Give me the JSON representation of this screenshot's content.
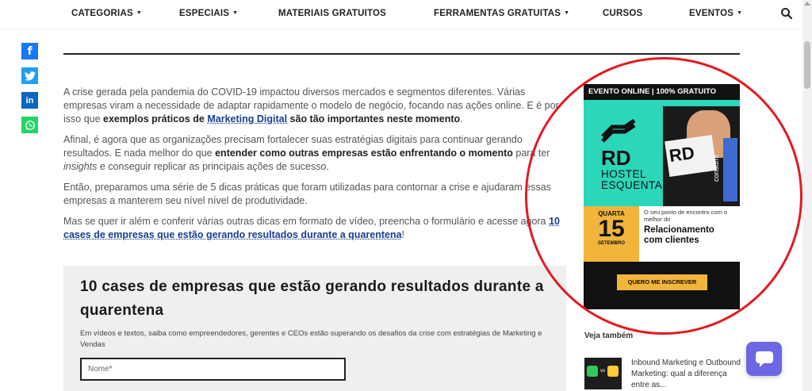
{
  "nav": {
    "items": [
      {
        "label": "CATEGORIAS",
        "dropdown": true
      },
      {
        "label": "ESPECIAIS",
        "dropdown": true
      },
      {
        "label": "MATERIAIS GRATUITOS",
        "dropdown": false
      },
      {
        "label": "FERRAMENTAS GRATUITAS",
        "dropdown": true
      },
      {
        "label": "CURSOS",
        "dropdown": false
      },
      {
        "label": "EVENTOS",
        "dropdown": true
      }
    ],
    "search_icon": "search-icon"
  },
  "share": {
    "facebook": "f",
    "twitter_icon": "twitter-icon",
    "linkedin": "in",
    "whatsapp_icon": "whatsapp-icon"
  },
  "article": {
    "p1_text": "A crise gerada pela pandemia do COVID-19 impactou diversos mercados e segmentos diferentes. Várias empresas viram a necessidade de adaptar rapidamente o modelo de negócio, focando nas ações online. E é por isso que ",
    "p1_bold1": "exemplos práticos de ",
    "p1_link": "Marketing Digital",
    "p1_bold2": " são tão importantes neste momento",
    "p1_end": ".",
    "p2_text1": "Afinal, é agora que as organizações precisam fortalecer suas estratégias digitais para continuar gerando resultados. E nada melhor do que ",
    "p2_bold": "entender como outras empresas estão enfrentando o momento",
    "p2_text2": " para ter ",
    "p2_italic": "insights",
    "p2_text3": " e conseguir replicar as principais ações de sucesso.",
    "p3_text": "Então, preparamos uma série de 5 dicas práticas que foram utilizadas para contornar a crise e ajudaram essas empresas a manterem seu nível nível de produtividade.",
    "p4_text": "Mas se quer ir além e conferir várias outras dicas em formato de vídeo, preencha o formulário e acesse agora ",
    "p4_link": "10 cases de empresas que estão gerando resultados durante a quarentena",
    "p4_end": "!"
  },
  "form": {
    "title": "10 cases de empresas que estão gerando resultados durante a quarentena",
    "description": "Em vídeos e textos, saiba como empreendedores, gerentes e CEOs estão superando os desafios da crise com estratégias de Marketing e Vendas",
    "name_placeholder": "Nome*"
  },
  "ad": {
    "top_text": "EVENTO ONLINE | 100% GRATUITO",
    "rd": "RD",
    "hostel_line1": "HOSTEL",
    "hostel_line2": "ESQUENTA",
    "collage_rd": "RD",
    "collage_text": "consumi",
    "weekday": "QUARTA",
    "day": "15",
    "month": "SETEMBRO",
    "subtitle": "O seu ponto de encontro com o melhor do",
    "headline": "Relacionamento com clientes",
    "cta": "QUERO ME INSCREVER"
  },
  "sidebar": {
    "veja_tambem": "Veja também",
    "related_title": "Inbound Marketing e Outbound Marketing: qual a diferença entre as...",
    "thumb_text": "vs"
  },
  "colors": {
    "facebook": "#1877f2",
    "twitter": "#1da1f2",
    "linkedin": "#0a66c2",
    "whatsapp": "#25d366",
    "ad_teal": "#2bd6b9",
    "ad_yellow": "#f2b53b",
    "annotation_red": "#e11b22",
    "chat_purple": "#6d67e4",
    "link_blue": "#1a3d8f"
  }
}
